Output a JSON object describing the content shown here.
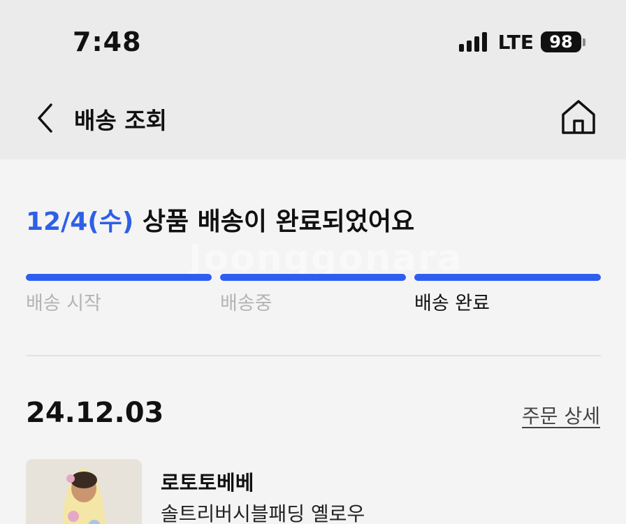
{
  "status_bar": {
    "time": "7:48",
    "network": "LTE",
    "battery": "98"
  },
  "nav": {
    "back_icon": "chevron-left-icon",
    "title": "배송 조회",
    "home_icon": "home-icon"
  },
  "delivery": {
    "headline_date": "12/4(수)",
    "headline_text": " 상품 배송이 완료되었어요",
    "watermark": "Joonggonara",
    "steps": [
      {
        "label": "배송 시작",
        "active": false
      },
      {
        "label": "배송중",
        "active": false
      },
      {
        "label": "배송 완료",
        "active": true
      }
    ],
    "progress_color": "#2e5ef0"
  },
  "order": {
    "date": "24.12.03",
    "detail_link": "주문 상세",
    "brand": "로토토베베",
    "product_name": "솔트리버시블패딩 옐로우"
  },
  "colors": {
    "accent": "#2f5fe6",
    "header_bg": "#ebebeb",
    "page_bg": "#f4f4f4"
  }
}
